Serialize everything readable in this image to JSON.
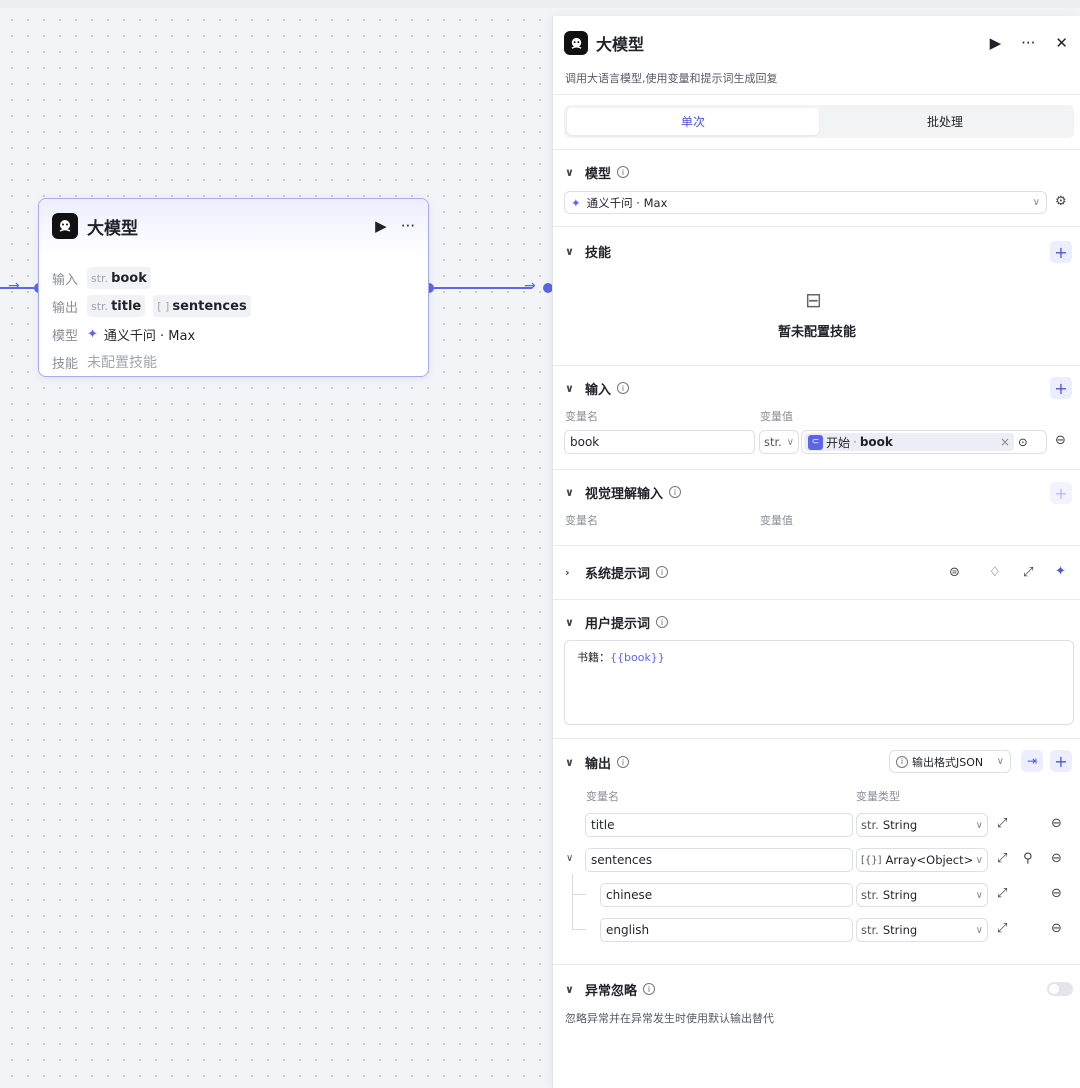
{
  "node": {
    "title": "大模型",
    "run_icon": "▶",
    "more_icon": "···",
    "input_label": "输入",
    "inputs": [
      {
        "type": "str.",
        "name": "book"
      }
    ],
    "output_label": "输出",
    "outputs": [
      {
        "type": "str.",
        "name": "title"
      },
      {
        "type": "[ ]",
        "name": "sentences"
      }
    ],
    "model_label": "模型",
    "model_value": "通义千问 · Max",
    "skill_label": "技能",
    "skill_value": "未配置技能"
  },
  "panel": {
    "title": "大模型",
    "description": "调用大语言模型,使用变量和提示词生成回复",
    "tabs": [
      "单次",
      "批处理"
    ],
    "active_tab": "单次",
    "model": {
      "section": "模型",
      "value": "通义千问 · Max"
    },
    "skills": {
      "section": "技能",
      "empty": "暂未配置技能"
    },
    "input": {
      "section": "输入",
      "col_name": "变量名",
      "col_value": "变量值",
      "rows": [
        {
          "name": "book",
          "type": "str.",
          "ref_badge": "⊂",
          "ref_source": "开始",
          "ref_sep": "·",
          "ref_var": "book"
        }
      ]
    },
    "vision": {
      "section": "视觉理解输入",
      "col_name": "变量名",
      "col_value": "变量值"
    },
    "system_prompt": {
      "section": "系统提示词"
    },
    "user_prompt": {
      "section": "用户提示词",
      "text_prefix": "书籍：",
      "text_var": "{{book}}"
    },
    "output": {
      "section": "输出",
      "format": "输出格式JSON",
      "col_name": "变量名",
      "col_type": "变量类型",
      "rows": [
        {
          "name": "title",
          "type": "String",
          "type_prefix": "str."
        },
        {
          "name": "sentences",
          "type": "Array<Object>",
          "type_prefix": "[{}]"
        },
        {
          "name": "chinese",
          "type": "String",
          "type_prefix": "str."
        },
        {
          "name": "english",
          "type": "String",
          "type_prefix": "str."
        }
      ]
    },
    "exception": {
      "section": "异常忽略",
      "description": "忽略异常并在异常发生时使用默认输出替代",
      "enabled": false
    }
  }
}
